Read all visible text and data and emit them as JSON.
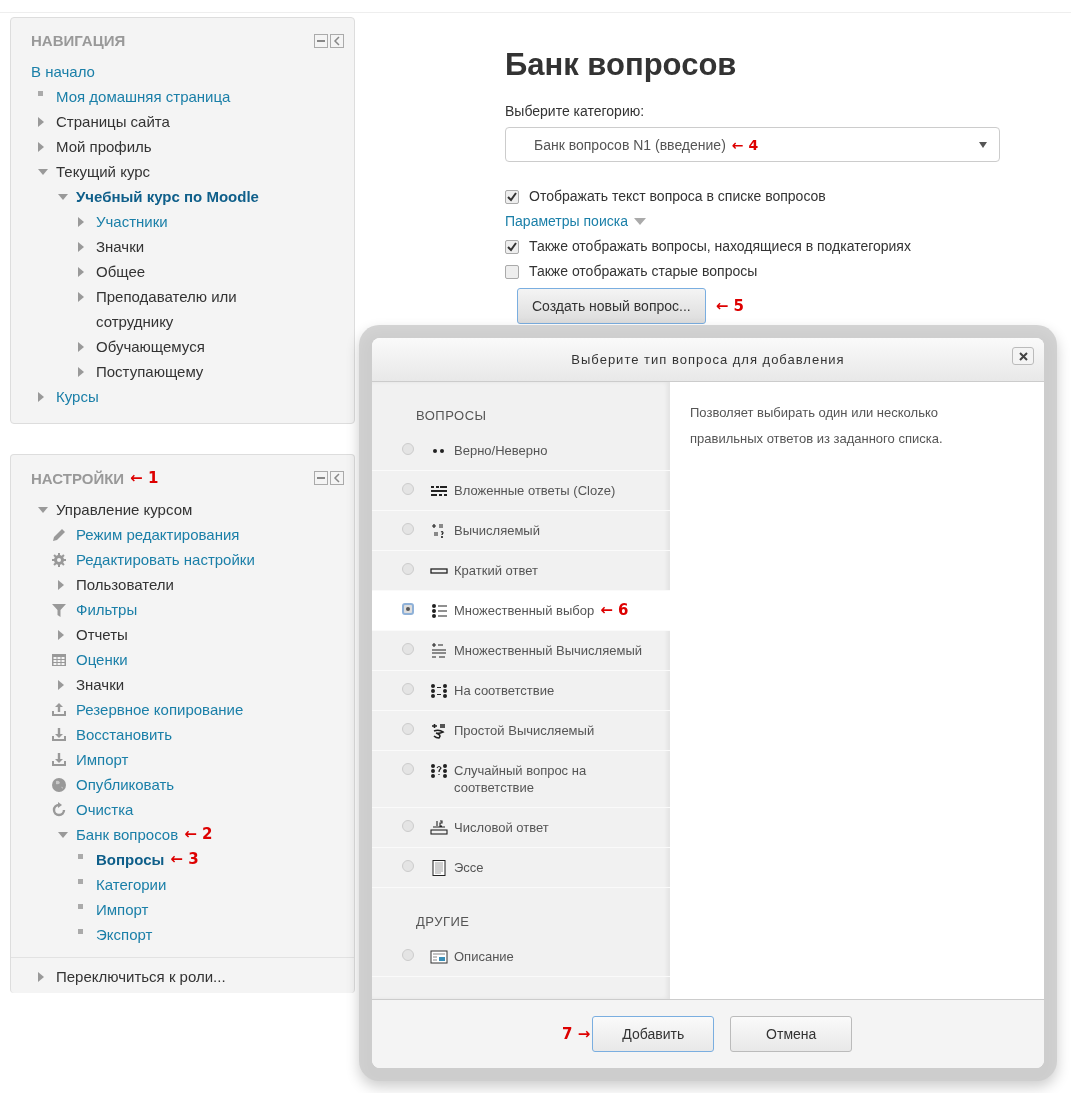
{
  "navigation": {
    "title": "НАВИГАЦИЯ",
    "items": [
      {
        "label": "В начало",
        "kind": "plain",
        "link": true,
        "current": false
      },
      {
        "label": "Моя домашняя страница",
        "kind": "bullet",
        "link": true,
        "current": false
      },
      {
        "label": "Страницы сайта",
        "kind": "collapsed",
        "link": false,
        "current": false
      },
      {
        "label": "Мой профиль",
        "kind": "collapsed",
        "link": false,
        "current": false
      },
      {
        "label": "Текущий курс",
        "kind": "expanded",
        "link": false,
        "current": false,
        "children": [
          {
            "label": "Учебный курс по Moodle",
            "kind": "expanded",
            "link": true,
            "current": true,
            "children": [
              {
                "label": "Участники",
                "kind": "collapsed",
                "link": true,
                "current": false
              },
              {
                "label": "Значки",
                "kind": "collapsed",
                "link": false,
                "current": false
              },
              {
                "label": "Общее",
                "kind": "collapsed",
                "link": false,
                "current": false
              },
              {
                "label": "Преподавателю или сотруднику",
                "kind": "collapsed",
                "link": false,
                "current": false
              },
              {
                "label": "Обучающемуся",
                "kind": "collapsed",
                "link": false,
                "current": false
              },
              {
                "label": "Поступающему",
                "kind": "collapsed",
                "link": false,
                "current": false
              }
            ]
          }
        ]
      },
      {
        "label": "Курсы",
        "kind": "collapsed",
        "link": true,
        "current": false
      }
    ]
  },
  "settings": {
    "title": "НАСТРОЙКИ",
    "annotation": "← 1",
    "items": [
      {
        "label": "Управление курсом",
        "kind": "expanded",
        "link": false,
        "current": false,
        "children": [
          {
            "label": "Режим редактирования",
            "kind": "pencil",
            "link": true,
            "current": false
          },
          {
            "label": "Редактировать настройки",
            "kind": "gear",
            "link": true,
            "current": false
          },
          {
            "label": "Пользователи",
            "kind": "collapsed",
            "link": false,
            "current": false
          },
          {
            "label": "Фильтры",
            "kind": "filter",
            "link": true,
            "current": false
          },
          {
            "label": "Отчеты",
            "kind": "collapsed",
            "link": false,
            "current": false
          },
          {
            "label": "Оценки",
            "kind": "grid",
            "link": true,
            "current": false
          },
          {
            "label": "Значки",
            "kind": "collapsed",
            "link": false,
            "current": false
          },
          {
            "label": "Резервное копирование",
            "kind": "upload",
            "link": true,
            "current": false
          },
          {
            "label": "Восстановить",
            "kind": "download",
            "link": true,
            "current": false
          },
          {
            "label": "Импорт",
            "kind": "download",
            "link": true,
            "current": false
          },
          {
            "label": "Опубликовать",
            "kind": "globe",
            "link": true,
            "current": false
          },
          {
            "label": "Очистка",
            "kind": "refresh",
            "link": true,
            "current": false
          },
          {
            "label": "Банк вопросов",
            "kind": "expanded",
            "link": true,
            "current": false,
            "annotation": "← 2",
            "children": [
              {
                "label": "Вопросы",
                "kind": "bullet",
                "link": true,
                "current": true,
                "annotation": "← 3"
              },
              {
                "label": "Категории",
                "kind": "bullet",
                "link": true,
                "current": false
              },
              {
                "label": "Импорт",
                "kind": "bullet",
                "link": true,
                "current": false
              },
              {
                "label": "Экспорт",
                "kind": "bullet",
                "link": true,
                "current": false
              }
            ]
          }
        ]
      }
    ],
    "footer_item": {
      "label": "Переключиться к роли...",
      "kind": "collapsed",
      "link": false,
      "current": false
    }
  },
  "main": {
    "title": "Банк вопросов",
    "category_label": "Выберите категорию:",
    "category_select": {
      "value": "Банк вопросов N1 (введение)",
      "annotation": "← 4"
    },
    "show_text_checkbox": {
      "label": "Отображать текст вопроса в списке вопросов",
      "checked": true
    },
    "search_options_link": "Параметры поиска",
    "search_checkboxes": [
      {
        "label": "Также отображать вопросы, находящиеся в подкатегориях",
        "checked": true
      },
      {
        "label": "Также отображать старые вопросы",
        "checked": false
      }
    ],
    "create_button": {
      "label": "Создать новый вопрос...",
      "annotation": "← 5"
    }
  },
  "dialog": {
    "title": "Выберите тип вопроса для добавления",
    "sections": [
      {
        "heading": "ВОПРОСЫ",
        "options": [
          {
            "label": "Верно/Неверно",
            "kind": "truefalse",
            "selected": false
          },
          {
            "label": "Вложенные ответы (Cloze)",
            "kind": "cloze",
            "selected": false
          },
          {
            "label": "Вычисляемый",
            "kind": "calculated",
            "selected": false
          },
          {
            "label": "Краткий ответ",
            "kind": "shortanswer",
            "selected": false
          },
          {
            "label": "Множественный выбор",
            "kind": "multichoice",
            "selected": true,
            "annotation": "← 6"
          },
          {
            "label": "Множественный Вычисляемый",
            "kind": "calculatedmulti",
            "selected": false
          },
          {
            "label": "На соответствие",
            "kind": "match",
            "selected": false
          },
          {
            "label": "Простой Вычисляемый",
            "kind": "calculatedsimple",
            "selected": false
          },
          {
            "label": "Случайный вопрос на соответствие",
            "kind": "randommatch",
            "selected": false
          },
          {
            "label": "Числовой ответ",
            "kind": "numerical",
            "selected": false
          },
          {
            "label": "Эссе",
            "kind": "essay",
            "selected": false
          }
        ]
      },
      {
        "heading": "ДРУГИЕ",
        "options": [
          {
            "label": "Описание",
            "kind": "description",
            "selected": false
          }
        ]
      }
    ],
    "description": "Позволяет выбирать один или несколько правильных ответов из заданного списка.",
    "buttons": [
      {
        "label": "Добавить",
        "kind": "primary",
        "annotation": "7 →"
      },
      {
        "label": "Отмена",
        "kind": "secondary"
      }
    ]
  }
}
